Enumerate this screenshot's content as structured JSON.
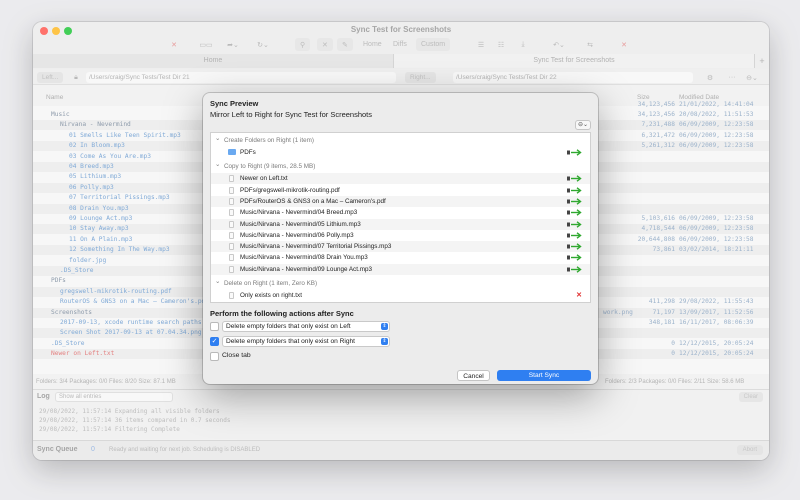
{
  "window": {
    "title": "Sync Test for Screenshots",
    "toolbar": {
      "home": "Home",
      "diffs": "Diffs",
      "custom": "Custom"
    },
    "tabs": [
      "Home",
      "Sync Test for Screenshots"
    ],
    "left_button": "Left...",
    "right_button": "Right...",
    "left_path": "/Users/craig/Sync Tests/Test Dir 21",
    "right_path": "/Users/craig/Sync Tests/Test Dir 22"
  },
  "columns": {
    "name": "Name",
    "size": "Size",
    "modified": "Modified Date"
  },
  "tree_rows": [
    {
      "text": "Music",
      "indent": 0,
      "type": "folder"
    },
    {
      "text": "Nirvana - Nevermind",
      "indent": 1,
      "type": "folder"
    },
    {
      "text": "01 Smells Like Teen Spirit.mp3",
      "indent": 2,
      "type": "file"
    },
    {
      "text": "02 In Bloom.mp3",
      "indent": 2,
      "type": "file"
    },
    {
      "text": "03 Come As You Are.mp3",
      "indent": 2,
      "type": "file"
    },
    {
      "text": "04 Breed.mp3",
      "indent": 2,
      "type": "file"
    },
    {
      "text": "05 Lithium.mp3",
      "indent": 2,
      "type": "file"
    },
    {
      "text": "06 Polly.mp3",
      "indent": 2,
      "type": "file"
    },
    {
      "text": "07 Territorial Pissings.mp3",
      "indent": 2,
      "type": "file"
    },
    {
      "text": "08 Drain You.mp3",
      "indent": 2,
      "type": "file"
    },
    {
      "text": "09 Lounge Act.mp3",
      "indent": 2,
      "type": "file"
    },
    {
      "text": "10 Stay Away.mp3",
      "indent": 2,
      "type": "file"
    },
    {
      "text": "11 On A Plain.mp3",
      "indent": 2,
      "type": "file"
    },
    {
      "text": "12 Something In The Way.mp3",
      "indent": 2,
      "type": "file"
    },
    {
      "text": "folder.jpg",
      "indent": 2,
      "type": "file"
    },
    {
      "text": ".DS_Store",
      "indent": 1,
      "type": "file"
    },
    {
      "text": "PDFs",
      "indent": 0,
      "type": "folder"
    },
    {
      "text": "gregswell-mikrotik-routing.pdf",
      "indent": 1,
      "type": "file"
    },
    {
      "text": "RouterOS & GNS3 on a Mac – Cameron's.pd",
      "indent": 1,
      "type": "file"
    },
    {
      "text": "Screenshots",
      "indent": 0,
      "type": "folder"
    },
    {
      "text": "2017-09-13, xcode runtime search paths fc",
      "indent": 1,
      "type": "file"
    },
    {
      "text": "Screen Shot 2017-09-13 at 07.04.34.png",
      "indent": 1,
      "type": "file"
    },
    {
      "text": ".DS_Store",
      "indent": 0,
      "type": "file"
    },
    {
      "text": "Newer on Left.txt",
      "indent": 0,
      "type": "red"
    }
  ],
  "right_rows": [
    {
      "size": "34,123,456",
      "date": "21/01/2022, 14:41:04"
    },
    {
      "size": "34,123,456",
      "date": "20/08/2022, 11:51:53"
    },
    {
      "size": "7,231,488",
      "date": "06/09/2009, 12:23:58"
    },
    {
      "size": "6,321,472",
      "date": "06/09/2009, 12:23:58"
    },
    {
      "size": "5,261,312",
      "date": "06/09/2009, 12:23:58"
    },
    {
      "size": "",
      "date": ""
    },
    {
      "size": "",
      "date": ""
    },
    {
      "size": "",
      "date": ""
    },
    {
      "size": "",
      "date": ""
    },
    {
      "size": "",
      "date": ""
    },
    {
      "size": "",
      "date": ""
    },
    {
      "size": "5,103,616",
      "date": "06/09/2009, 12:23:58"
    },
    {
      "size": "4,718,544",
      "date": "06/09/2009, 12:23:58"
    },
    {
      "size": "20,644,808",
      "date": "06/09/2009, 12:23:58"
    },
    {
      "size": "73,861",
      "date": "03/02/2014, 18:21:11"
    },
    {
      "size": "",
      "date": ""
    },
    {
      "size": "",
      "date": ""
    },
    {
      "size": "",
      "date": ""
    },
    {
      "size": "",
      "date": ""
    },
    {
      "size": "411,298",
      "date": "29/08/2022, 11:55:43"
    },
    {
      "size": "71,197",
      "date": "13/09/2017, 11:52:56"
    },
    {
      "size": "348,181",
      "date": "16/11/2017, 08:06:39"
    },
    {
      "size": "",
      "date": ""
    },
    {
      "size": "0",
      "date": "12/12/2015, 20:05:24"
    },
    {
      "size": "0",
      "date": "12/12/2015, 20:05:24"
    }
  ],
  "right_extra": "work.png",
  "status_left": "Folders: 3/4   Packages: 0/0   Files: 8/20   Size: 87.1 MB",
  "status_right": "Folders: 2/3   Packages: 0/0   Files: 2/11   Size: 58.6 MB",
  "log": {
    "label": "Log",
    "filter": "Show all entries",
    "clear": "Clear",
    "lines": [
      "29/08/2022, 11:57:14  Expanding all visible folders",
      "29/08/2022, 11:57:14  36 items compared in 0.7 seconds",
      "29/08/2022, 11:57:14  Filtering Complete"
    ]
  },
  "queue": {
    "label": "Sync Queue",
    "count": "0",
    "status": "Ready and waiting for next job.  Scheduling is DISABLED",
    "abort": "Abort"
  },
  "dialog": {
    "heading": "Sync Preview",
    "subtitle": "Mirror Left to Right for Sync Test for Screenshots",
    "sections": [
      {
        "title": "Create Folders on Right (1 item)",
        "items": [
          "PDFs"
        ]
      },
      {
        "title": "Copy to Right (9 items, 28.5 MB)",
        "items": [
          "Newer on Left.txt",
          "PDFs/gregswell-mikrotik-routing.pdf",
          "PDFs/RouterOS & GNS3 on a Mac – Cameron's.pdf",
          "Music/Nirvana - Nevermind/04 Breed.mp3",
          "Music/Nirvana - Nevermind/05 Lithium.mp3",
          "Music/Nirvana - Nevermind/06 Polly.mp3",
          "Music/Nirvana - Nevermind/07 Territorial Pissings.mp3",
          "Music/Nirvana - Nevermind/08 Drain You.mp3",
          "Music/Nirvana - Nevermind/09 Lounge Act.mp3"
        ]
      },
      {
        "title": "Delete on Right (1 item, Zero KB)",
        "items": [
          "Only exists on right.txt"
        ]
      }
    ],
    "after_heading": "Perform the following actions after Sync",
    "option1": "Delete empty folders that only exist on Left",
    "option2": "Delete empty folders that only exist on Right",
    "close_tab": "Close tab",
    "cancel": "Cancel",
    "start": "Start Sync"
  },
  "colors": {
    "accent": "#2f7ff1",
    "green_arrow": "#2fa82f",
    "delete_red": "#e02b2b",
    "tree_blue": "#6e9ed2",
    "tree_red": "#e07070"
  }
}
